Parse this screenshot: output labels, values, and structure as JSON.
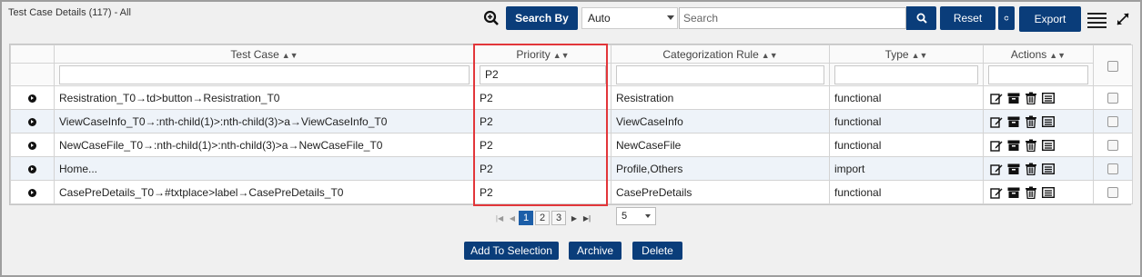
{
  "page": {
    "title": "Test Case Details (117) - All"
  },
  "toolbar": {
    "search_by_label": "Search By",
    "search_mode": "Auto",
    "search_placeholder": "Search",
    "reset_label": "Reset",
    "export_label": "Export"
  },
  "table": {
    "columns": [
      {
        "label": "Test Case",
        "filter": ""
      },
      {
        "label": "Priority",
        "filter": "P2"
      },
      {
        "label": "Categorization Rule",
        "filter": ""
      },
      {
        "label": "Type",
        "filter": ""
      },
      {
        "label": "Actions",
        "filter": ""
      }
    ],
    "rows": [
      {
        "test_case": "Resistration_T0→td>button→Resistration_T0",
        "priority": "P2",
        "rule": "Resistration",
        "type": "functional"
      },
      {
        "test_case": "ViewCaseInfo_T0→:nth-child(1)>:nth-child(3)>a→ViewCaseInfo_T0",
        "priority": "P2",
        "rule": "ViewCaseInfo",
        "type": "functional"
      },
      {
        "test_case": "NewCaseFile_T0→:nth-child(1)>:nth-child(3)>a→NewCaseFile_T0",
        "priority": "P2",
        "rule": "NewCaseFile",
        "type": "functional"
      },
      {
        "test_case": "Home...",
        "priority": "P2",
        "rule": "Profile,Others",
        "type": "import"
      },
      {
        "test_case": "CasePreDetails_T0→#txtplace>label→CasePreDetails_T0",
        "priority": "P2",
        "rule": "CasePreDetails",
        "type": "functional"
      }
    ]
  },
  "pagination": {
    "pages": [
      "1",
      "2",
      "3"
    ],
    "current_page": "1",
    "page_size": "5"
  },
  "actions": {
    "add_label": "Add To Selection",
    "archive_label": "Archive",
    "delete_label": "Delete"
  },
  "colors": {
    "primary": "#0a3d7a",
    "highlight": "#e2363a",
    "row_alt": "#eef3f9"
  }
}
